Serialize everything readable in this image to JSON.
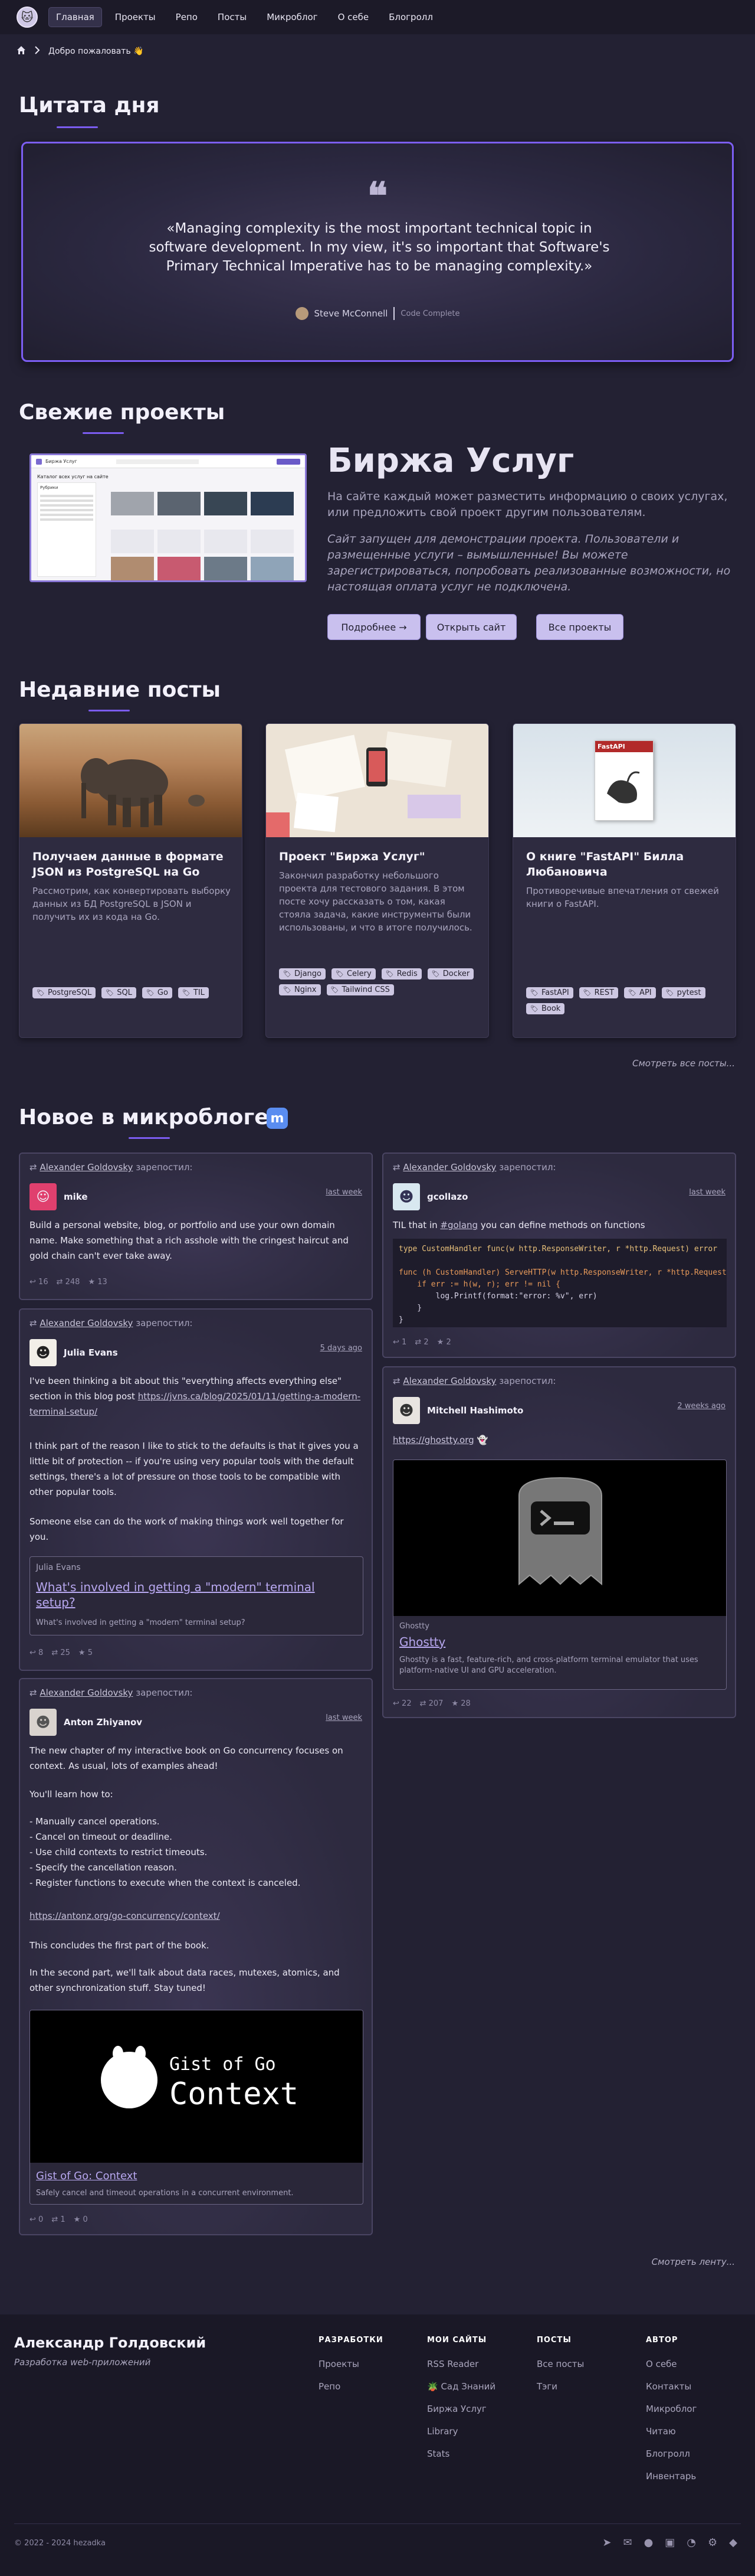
{
  "nav": {
    "logo_icon": "cat-avatar-icon",
    "items": [
      {
        "label": "Главная",
        "active": true
      },
      {
        "label": "Проекты"
      },
      {
        "label": "Репо"
      },
      {
        "label": "Посты"
      },
      {
        "label": "Микроблог"
      },
      {
        "label": "О себе"
      },
      {
        "label": "Блогролл"
      }
    ]
  },
  "breadcrumb": {
    "home_icon": "home-icon",
    "sep_icon": "chevron-right-icon",
    "label": "Добро пожаловать 👋"
  },
  "quote_section": {
    "title": "Цитата дня",
    "text": "«Managing complexity is the most important technical topic in software development. In my view, it's so important that Software's Primary Technical Imperative has to be managing complexity.»",
    "author": "Steve McConnell",
    "source": "Code Complete"
  },
  "projects_section": {
    "title": "Свежие проекты",
    "project_title": "Биржа Услуг",
    "desc": "На сайте каждый может разместить информацию о своих услугах, или предложить свой проект другим пользователям.",
    "desc_italic": "Сайт запущен для демонстрации проекта. Пользователи и размещенные услуги – вымышленные! Вы можете зарегистрироваться, попробовать реализованные возможности, но настоящая оплата услуг не подключена.",
    "btn_more": "Подробнее →",
    "btn_open": "Открыть сайт",
    "btn_all": "Все проекты",
    "screenshot": {
      "brand": "Биржа Услуг",
      "heading": "Каталог всех услуг на сайте",
      "filter": "Рубрики"
    }
  },
  "posts_section": {
    "title": "Недавние посты",
    "see_all": "Смотреть все посты...",
    "posts": [
      {
        "title": "Получаем данные в формате JSON из PostgreSQL на Go",
        "desc": "Рассмотрим, как конвертировать выборку данных из БД PostgreSQL в JSON и получить их из кода на Go.",
        "tags": [
          "PostgreSQL",
          "SQL",
          "Go",
          "TIL"
        ]
      },
      {
        "title": "Проект \"Биржа Услуг\"",
        "desc": "Закончил разработку небольшого проекта для тестового задания. В этом посте хочу рассказать о том, какая стояла задача, какие инструменты были использованы, и что в итоге получилось.",
        "tags": [
          "Django",
          "Celery",
          "Redis",
          "Docker",
          "Nginx",
          "Tailwind CSS"
        ]
      },
      {
        "title": "О книге \"FastAPI\" Билла Любановича",
        "desc": "Противоречивые впечатления от свежей книги о FastAPI.",
        "tags": [
          "FastAPI",
          "REST",
          "API",
          "pytest",
          "Book"
        ],
        "book_cover": "FastAPI"
      }
    ]
  },
  "micro_section": {
    "title": "Новое в микроблоге",
    "see_all": "Смотреть ленту...",
    "boosted_by": "Alexander Goldovsky",
    "boosted_word": "зарепостил:",
    "posts": [
      {
        "user": "mike",
        "time": "last week",
        "body": "Build a personal website, blog, or portfolio and use your own domain name. Make something that a rich asshole with the cringest haircut and gold chain can't ever take away.",
        "replies": "16",
        "boosts": "248",
        "favs": "13"
      },
      {
        "user": "Julia Evans",
        "time": "5 days ago",
        "body1": "I've been thinking a bit about this \"everything affects everything else\" section in this blog post ",
        "link1": "https://jvns.ca/blog/2025/01/11/getting-a-modern-terminal-setup/",
        "body2": "I think part of the reason I like to stick to the defaults is that it gives you a little bit of protection -- if you're using very popular tools with the default settings, there's a lot of pressure on those tools to be compatible with other popular tools.",
        "body3": "Someone else can do the work of making things work well together for you.",
        "card_author": "Julia Evans",
        "card_title": "What's involved in getting a \"modern\" terminal setup?",
        "card_desc": "What's involved in getting a \"modern\" terminal setup?",
        "replies": "8",
        "boosts": "25",
        "favs": "5"
      },
      {
        "user": "Anton Zhiyanov",
        "time": "last week",
        "intro": "The new chapter of my interactive book on Go concurrency focuses on context. As usual, lots of examples ahead!",
        "learn": "You'll learn how to:",
        "list": [
          "- Manually cancel operations.",
          "- Cancel on timeout or deadline.",
          "- Use child contexts to restrict timeouts.",
          "- Specify the cancellation reason.",
          "- Register functions to execute when the context is canceled."
        ],
        "link": "https://antonz.org/go-concurrency/context/",
        "outro1": "This concludes the first part of the book.",
        "outro2": "In the second part, we'll talk about data races, mutexes, atomics, and other synchronization stuff. Stay tuned!",
        "img_line1": "Gist of Go",
        "img_line2": "Context",
        "card_title": "Gist of Go: Context",
        "card_desc": "Safely cancel and timeout operations in a concurrent environment.",
        "replies": "0",
        "boosts": "1",
        "favs": "0"
      },
      {
        "user": "gcollazo",
        "time": "last week",
        "body_pre": "TIL that in ",
        "hashtag": "#golang",
        "body_post": " you can define methods on functions",
        "code": [
          "type CustomHandler func(w http.ResponseWriter, r *http.Request) error",
          "",
          "func (h CustomHandler) ServeHTTP(w http.ResponseWriter, r *http.Request) {",
          "    if err := h(w, r); err != nil {",
          "        log.Printf(format:\"error: %v\", err)",
          "    }",
          "}"
        ],
        "replies": "1",
        "boosts": "2",
        "favs": "2"
      },
      {
        "user": "Mitchell Hashimoto",
        "time": "2 weeks ago",
        "link": "https://ghostty.org",
        "card_site": "Ghostty",
        "card_title": "Ghostty",
        "card_desc": "Ghostty is a fast, feature-rich, and cross-platform terminal emulator that uses platform-native UI and GPU acceleration.",
        "replies": "22",
        "boosts": "207",
        "favs": "28"
      }
    ]
  },
  "footer": {
    "name": "Александр Голдовский",
    "tagline": "Разработка web-приложений",
    "cols": [
      {
        "head": "РАЗРАБОТКИ",
        "items": [
          "Проекты",
          "Репо"
        ]
      },
      {
        "head": "МОИ САЙТЫ",
        "items": [
          "RSS Reader",
          "🪴 Сад Знаний",
          "Биржа Услуг",
          "Library",
          "Stats"
        ]
      },
      {
        "head": "ПОСТЫ",
        "items": [
          "Все посты",
          "Тэги"
        ]
      },
      {
        "head": "АВТОР",
        "items": [
          "О себе",
          "Контакты",
          "Микроблог",
          "Читаю",
          "Блогролл",
          "Инвентарь"
        ]
      }
    ],
    "copyright": "© 2022 - 2024 hezadka",
    "social_icons": [
      "telegram-icon",
      "mail-icon",
      "github-icon",
      "mastodon-icon",
      "rss-icon",
      "steam-icon",
      "leetcode-icon"
    ]
  }
}
